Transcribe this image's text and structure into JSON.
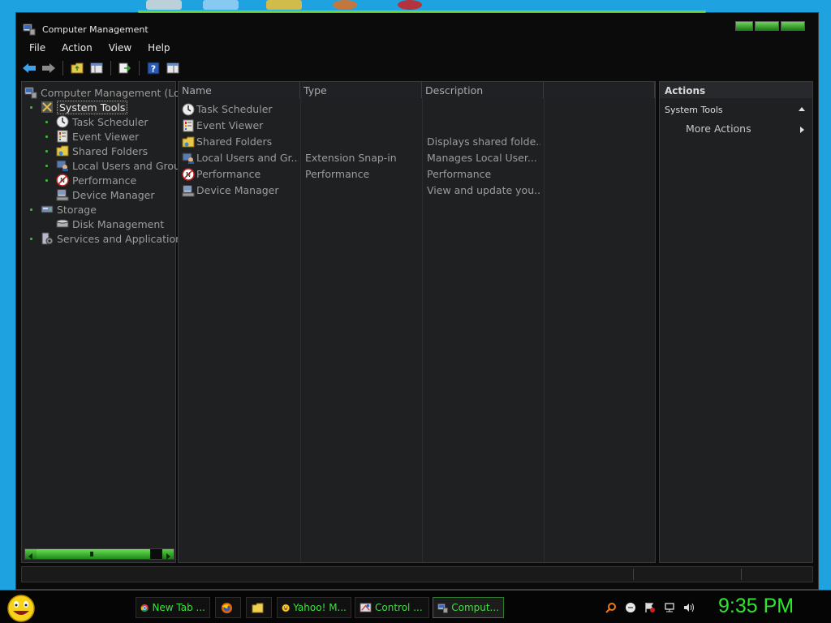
{
  "window": {
    "title": "Computer Management"
  },
  "menu": [
    "File",
    "Action",
    "View",
    "Help"
  ],
  "toolbar": [
    {
      "icon": "back-arrow-icon"
    },
    {
      "icon": "forward-arrow-icon"
    },
    {
      "icon": "folder-up-icon"
    },
    {
      "icon": "show-hide-tree-icon"
    },
    {
      "icon": "export-list-icon"
    },
    {
      "icon": "help-icon"
    },
    {
      "icon": "properties-icon"
    }
  ],
  "tree": [
    {
      "label": "Computer Management (Loc",
      "level": 0,
      "icon": "computer-management-icon",
      "dot": false,
      "selected": false
    },
    {
      "label": "System Tools",
      "level": 1,
      "icon": "system-tools-icon",
      "dot": true,
      "selected": true
    },
    {
      "label": "Task Scheduler",
      "level": 2,
      "icon": "clock-icon",
      "dot": true,
      "selected": false
    },
    {
      "label": "Event Viewer",
      "level": 2,
      "icon": "event-viewer-icon",
      "dot": true,
      "selected": false
    },
    {
      "label": "Shared Folders",
      "level": 2,
      "icon": "shared-folder-icon",
      "dot": true,
      "selected": false
    },
    {
      "label": "Local Users and Grou",
      "level": 2,
      "icon": "users-icon",
      "dot": true,
      "selected": false
    },
    {
      "label": "Performance",
      "level": 2,
      "icon": "performance-icon",
      "dot": true,
      "selected": false
    },
    {
      "label": "Device Manager",
      "level": 2,
      "icon": "device-manager-icon",
      "dot": false,
      "selected": false
    },
    {
      "label": "Storage",
      "level": 1,
      "icon": "storage-icon",
      "dot": true,
      "selected": false
    },
    {
      "label": "Disk Management",
      "level": 2,
      "icon": "disk-icon",
      "dot": false,
      "selected": false
    },
    {
      "label": "Services and Application",
      "level": 1,
      "icon": "services-icon",
      "dot": true,
      "selected": false
    }
  ],
  "list": {
    "columns": [
      "Name",
      "Type",
      "Description",
      ""
    ],
    "rows": [
      {
        "name": "Task Scheduler",
        "type": "",
        "description": "",
        "icon": "clock-icon"
      },
      {
        "name": "Event Viewer",
        "type": "",
        "description": "",
        "icon": "event-viewer-icon"
      },
      {
        "name": "Shared Folders",
        "type": "",
        "description": "Displays shared folde...",
        "icon": "shared-folder-icon"
      },
      {
        "name": "Local Users and Gr...",
        "type": "Extension Snap-in",
        "description": "Manages Local User...",
        "icon": "users-icon"
      },
      {
        "name": "Performance",
        "type": "Performance",
        "description": "Performance",
        "icon": "performance-icon"
      },
      {
        "name": "Device Manager",
        "type": "",
        "description": "View and update you...",
        "icon": "device-manager-icon"
      }
    ]
  },
  "actions": {
    "header": "Actions",
    "group": "System Tools",
    "more": "More Actions"
  },
  "taskbar": {
    "buttons": [
      {
        "label": "New Tab ...",
        "icon": "chrome-icon",
        "active": false
      },
      {
        "label": "",
        "icon": "firefox-icon",
        "active": false
      },
      {
        "label": "",
        "icon": "folder-icon",
        "active": false
      },
      {
        "label": "Yahoo! M...",
        "icon": "yahoo-messenger-icon",
        "active": false
      },
      {
        "label": "Control ...",
        "icon": "control-panel-icon",
        "active": false
      },
      {
        "label": "Comput...",
        "icon": "computer-management-icon",
        "active": true
      }
    ],
    "clock": "9:35 PM"
  },
  "colors": {
    "accent": "#2ee62e",
    "pane_bg": "#1f2022",
    "desktop": "#1fa3e0"
  }
}
